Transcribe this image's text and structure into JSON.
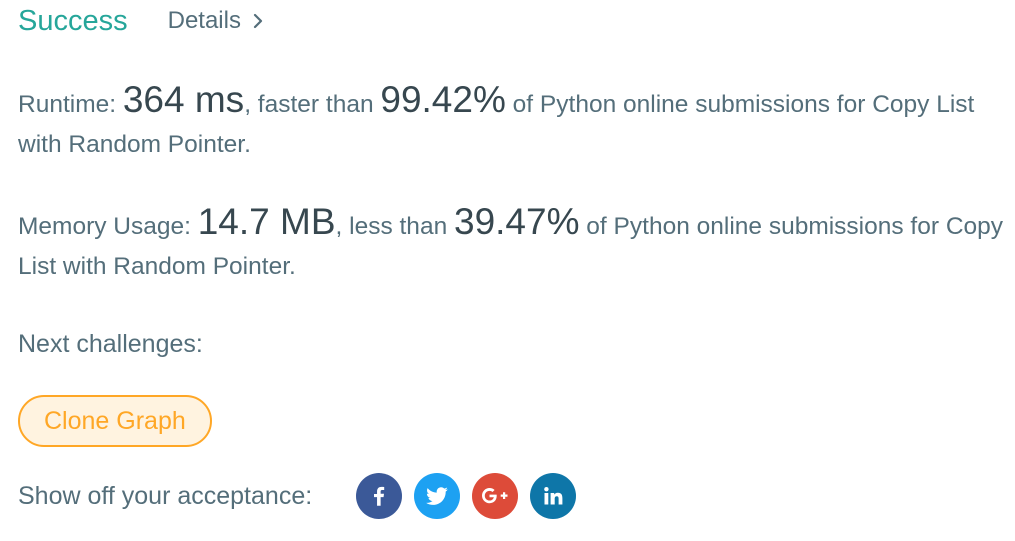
{
  "header": {
    "status": "Success",
    "details_label": "Details"
  },
  "runtime": {
    "label": "Runtime: ",
    "value": "364 ms",
    "comparison": ", faster than ",
    "percent": "99.42%",
    "suffix": " of Python online submissions for Copy List with Random Pointer."
  },
  "memory": {
    "label": "Memory Usage: ",
    "value": "14.7 MB",
    "comparison": ", less than ",
    "percent": "39.47%",
    "suffix": " of Python online submissions for Copy List with Random Pointer."
  },
  "next": {
    "label": "Next challenges:",
    "challenges": [
      "Clone Graph"
    ]
  },
  "share": {
    "label": "Show off your acceptance:",
    "icons": [
      {
        "name": "facebook-icon",
        "color": "#3b5998"
      },
      {
        "name": "twitter-icon",
        "color": "#1da1f2"
      },
      {
        "name": "google-plus-icon",
        "color": "#dd4b39"
      },
      {
        "name": "linkedin-icon",
        "color": "#0e76a8"
      }
    ]
  },
  "colors": {
    "success": "#26a69a",
    "text": "#546e7a",
    "emphasis": "#37474f",
    "challenge_border": "#ffa726",
    "challenge_bg": "#fff3e0"
  }
}
